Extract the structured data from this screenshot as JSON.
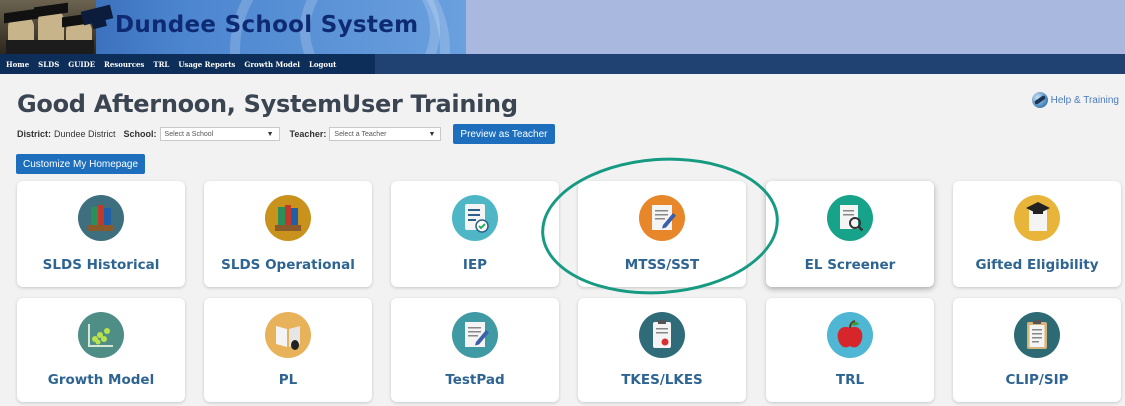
{
  "header": {
    "title": "Dundee School System"
  },
  "nav": [
    "Home",
    "SLDS",
    "GUIDE",
    "Resources",
    "TRL",
    "Usage Reports",
    "Growth Model",
    "Logout"
  ],
  "greeting": "Good Afternoon, SystemUser Training",
  "help_link": "Help & Training",
  "filters": {
    "district_label": "District:",
    "district_value": "Dundee District",
    "school_label": "School:",
    "school_placeholder": "Select a School",
    "teacher_label": "Teacher:",
    "teacher_placeholder": "Select a Teacher",
    "preview_button": "Preview as Teacher"
  },
  "customize_button": "Customize My Homepage",
  "tiles": [
    {
      "label": "SLDS Historical",
      "icon": "books-icon",
      "color": "#3e6f7e"
    },
    {
      "label": "SLDS Operational",
      "icon": "books-icon",
      "color": "#c9921d"
    },
    {
      "label": "IEP",
      "icon": "checklist-icon",
      "color": "#4fb6c6"
    },
    {
      "label": "MTSS/SST",
      "icon": "notepad-pencil-icon",
      "color": "#e8862a"
    },
    {
      "label": "EL Screener",
      "icon": "document-magnifier-icon",
      "color": "#16a38a"
    },
    {
      "label": "Gifted Eligibility",
      "icon": "graduation-cap-icon",
      "color": "#e9b43a"
    },
    {
      "label": "Growth Model",
      "icon": "scatter-chart-icon",
      "color": "#4f8d87"
    },
    {
      "label": "PL",
      "icon": "book-mouse-icon",
      "color": "#e8b25a"
    },
    {
      "label": "TestPad",
      "icon": "notepad-pencil-icon",
      "color": "#3f9aa3"
    },
    {
      "label": "TKES/LKES",
      "icon": "clipboard-apple-icon",
      "color": "#2f6b79"
    },
    {
      "label": "TRL",
      "icon": "apple-icon",
      "color": "#4fb6d4"
    },
    {
      "label": "CLIP/SIP",
      "icon": "clipboard-icon",
      "color": "#2e6a74"
    }
  ],
  "highlight": {
    "tile": "MTSS/SST",
    "color": "#169a82"
  }
}
